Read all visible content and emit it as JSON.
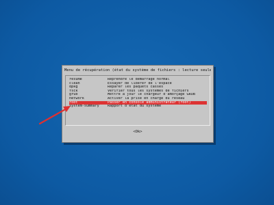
{
  "dialog": {
    "title": "Menu de récupération (état du système de fichiers : lecture seule)",
    "items": [
      {
        "key": "resume",
        "desc": "Reprendre le démarrage normal"
      },
      {
        "key": "clean",
        "desc": "Essayer de libérer de l'espace"
      },
      {
        "key": "dpkg",
        "desc": "Réparer les paquets cassés"
      },
      {
        "key": "fsck",
        "desc": "Vérifier tous les systèmes de fichiers"
      },
      {
        "key": "grub",
        "desc": "Mettre à jour le chargeur d'amorçage GRUB"
      },
      {
        "key": "network",
        "desc": "Activer la prise en charge du réseau"
      },
      {
        "key": "root",
        "desc": "Passer en console administrateur (root)"
      },
      {
        "key": "system-summary",
        "desc": "Rapport d'état du système"
      }
    ],
    "selected_index": 6,
    "ok_label": "<Ok>"
  },
  "colors": {
    "background": "#0e5fa8",
    "dialog": "#c6c6c6",
    "selection": "#dd3333",
    "arrow": "#e03030"
  }
}
